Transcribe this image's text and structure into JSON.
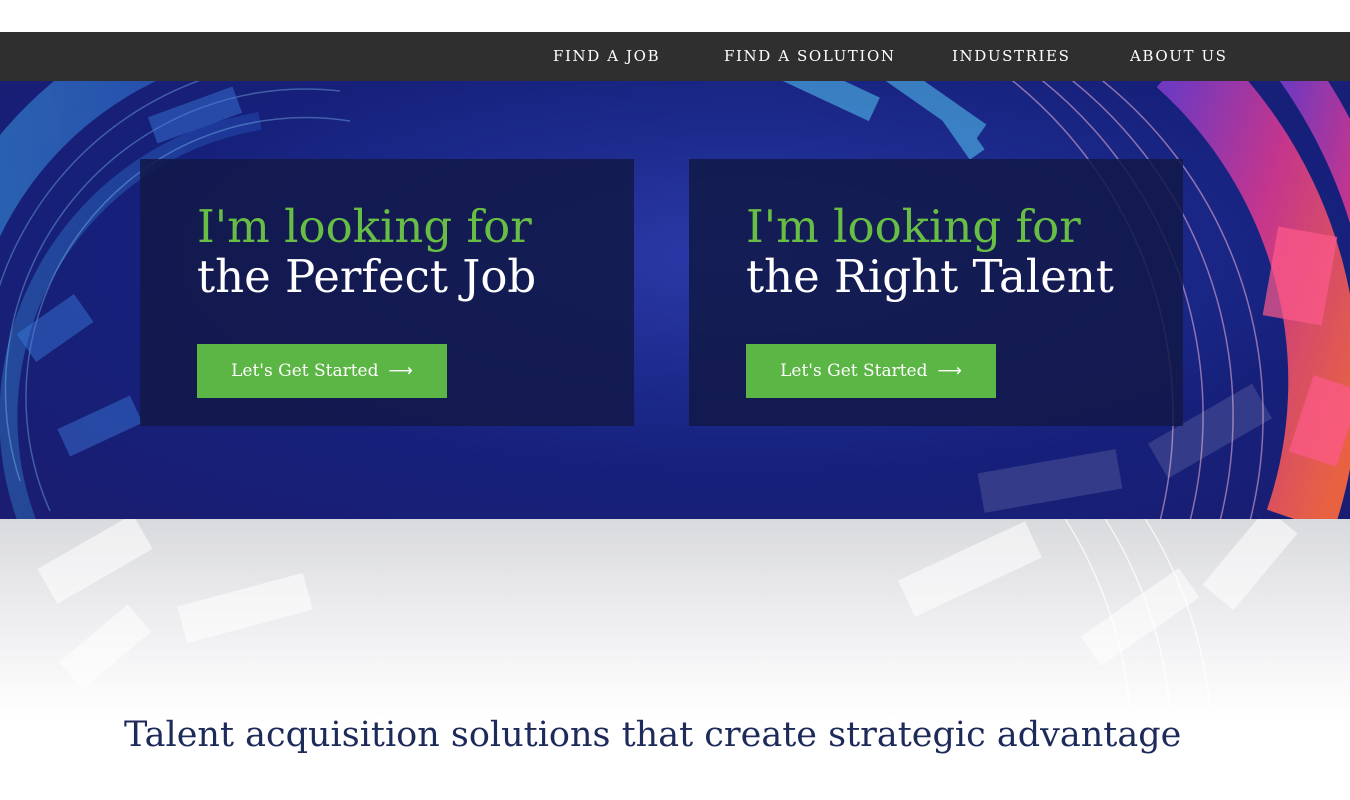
{
  "nav": {
    "items": [
      "FIND A JOB",
      "FIND A SOLUTION",
      "INDUSTRIES",
      "ABOUT US"
    ]
  },
  "cards": [
    {
      "line1": "I'm looking for",
      "line2": "the Perfect Job",
      "button_label": "Let's Get Started",
      "button_arrow": "⟶"
    },
    {
      "line1": "I'm looking for",
      "line2": "the Right Talent",
      "button_label": "Let's Get Started",
      "button_arrow": "⟶"
    }
  ],
  "tagline": "Talent acquisition solutions that create strategic advantage",
  "colors": {
    "nav_bg": "#2f2f2f",
    "accent_green": "#5cb645",
    "headline_green": "#68bd45",
    "card_bg": "#111848",
    "tagline_text": "#1d2a5a"
  },
  "icons": [
    "search-icon",
    "arrow-right-icon"
  ]
}
